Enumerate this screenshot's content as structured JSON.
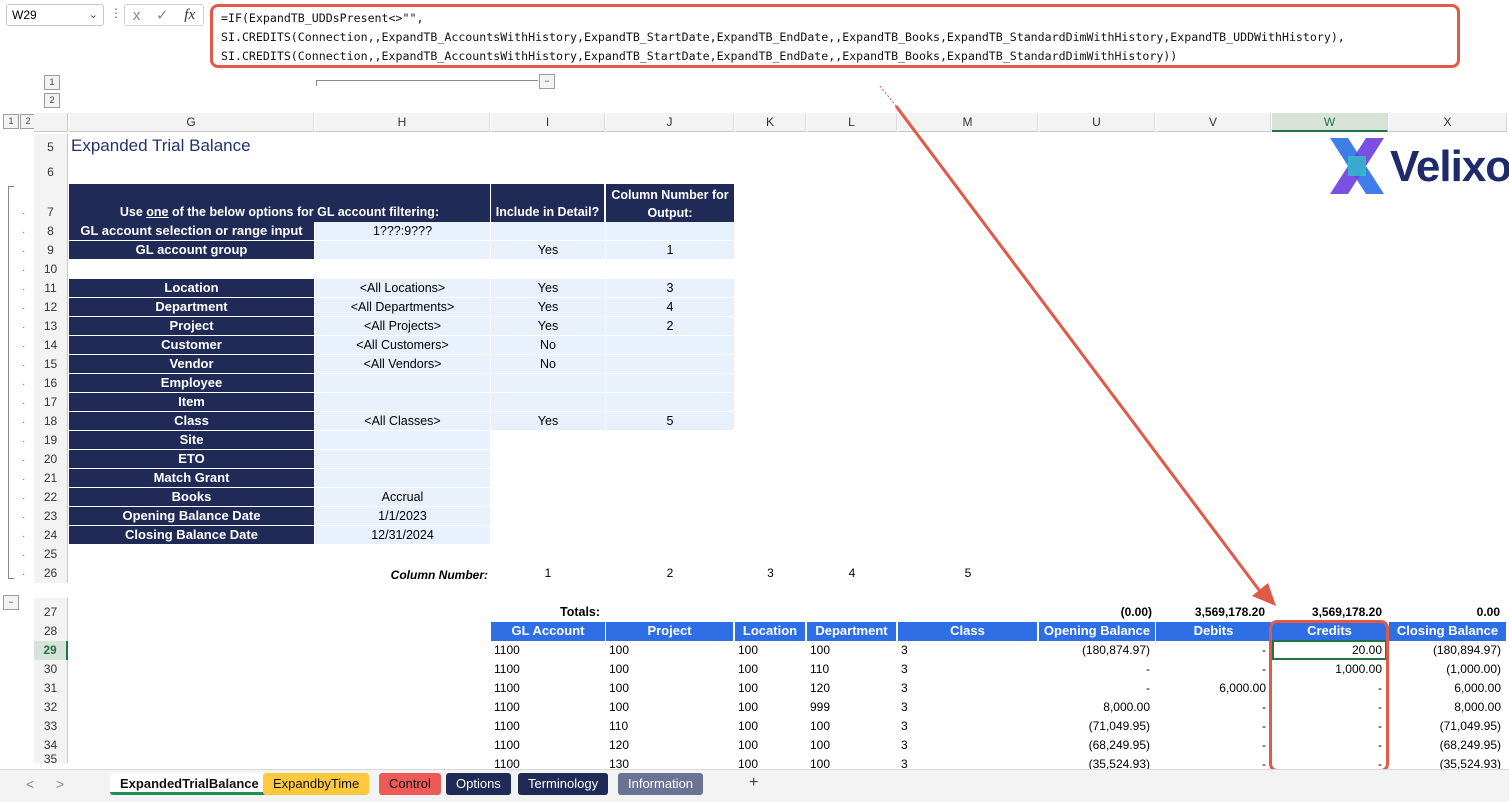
{
  "formula_bar": {
    "name_box": "W29",
    "formula_lines": [
      "=IF(ExpandTB_UDDsPresent<>\"\",",
      "SI.CREDITS(Connection,,ExpandTB_AccountsWithHistory,ExpandTB_StartDate,ExpandTB_EndDate,,ExpandTB_Books,ExpandTB_StandardDimWithHistory,ExpandTB_UDDWithHistory),",
      "SI.CREDITS(Connection,,ExpandTB_AccountsWithHistory,ExpandTB_StartDate,ExpandTB_EndDate,,ExpandTB_Books,ExpandTB_StandardDimWithHistory))"
    ],
    "fx_label": "fx",
    "cancel_icon": "x",
    "confirm_icon": "✓"
  },
  "outline": {
    "levels": [
      "1",
      "2"
    ],
    "collapse": "−"
  },
  "columns": [
    "G",
    "H",
    "I",
    "J",
    "K",
    "L",
    "M",
    "U",
    "V",
    "W",
    "X"
  ],
  "selected_column": "W",
  "rows": [
    "5",
    "6",
    "7",
    "8",
    "9",
    "10",
    "11",
    "12",
    "13",
    "14",
    "15",
    "16",
    "17",
    "18",
    "19",
    "20",
    "21",
    "22",
    "23",
    "24",
    "25",
    "26",
    "27",
    "28",
    "29",
    "30",
    "31",
    "32",
    "33",
    "34",
    "35"
  ],
  "selected_row": "29",
  "title": "Expanded Trial Balance",
  "logo_text": "Velixo",
  "filter_table": {
    "header_filter": "Use one of the below options for GL account filtering:",
    "header_filter_underlined": "one",
    "header_include": "Include in Detail?",
    "header_colnum": "Column Number for Output:",
    "rows": [
      {
        "label": "GL account selection or range input",
        "value": "1???:9???",
        "include": "",
        "colnum": ""
      },
      {
        "label": "GL account group",
        "value": "",
        "include": "Yes",
        "colnum": "1"
      },
      {
        "label": "Location",
        "value": "<All Locations>",
        "include": "Yes",
        "colnum": "3"
      },
      {
        "label": "Department",
        "value": "<All Departments>",
        "include": "Yes",
        "colnum": "4"
      },
      {
        "label": "Project",
        "value": "<All Projects>",
        "include": "Yes",
        "colnum": "2"
      },
      {
        "label": "Customer",
        "value": "<All Customers>",
        "include": "No",
        "colnum": ""
      },
      {
        "label": "Vendor",
        "value": "<All Vendors>",
        "include": "No",
        "colnum": ""
      },
      {
        "label": "Employee",
        "value": "",
        "include": "",
        "colnum": ""
      },
      {
        "label": "Item",
        "value": "",
        "include": "",
        "colnum": ""
      },
      {
        "label": "Class",
        "value": "<All Classes>",
        "include": "Yes",
        "colnum": "5"
      },
      {
        "label": "Site",
        "value": "",
        "include": "",
        "colnum": ""
      },
      {
        "label": "ETO",
        "value": "",
        "include": "",
        "colnum": ""
      },
      {
        "label": "Match Grant",
        "value": "",
        "include": "",
        "colnum": ""
      },
      {
        "label": "Books",
        "value": "Accrual",
        "include": "",
        "colnum": ""
      },
      {
        "label": "Opening Balance Date",
        "value": "1/1/2023",
        "include": "",
        "colnum": ""
      },
      {
        "label": "Closing Balance Date",
        "value": "12/31/2024",
        "include": "",
        "colnum": ""
      }
    ]
  },
  "column_number_row": {
    "label": "Column Number:",
    "values": [
      "1",
      "2",
      "3",
      "4",
      "5"
    ]
  },
  "totals": {
    "label": "Totals:",
    "opening": "(0.00)",
    "debits": "3,569,178.20",
    "credits": "3,569,178.20",
    "closing": "0.00"
  },
  "detail_headers": [
    "GL Account",
    "Project",
    "Location",
    "Department",
    "Class",
    "Opening Balance",
    "Debits",
    "Credits",
    "Closing Balance"
  ],
  "detail_rows": [
    {
      "gl": "1100",
      "project": "100",
      "location": "100",
      "department": "100",
      "class": "3",
      "opening": "(180,874.97)",
      "debits": "-",
      "credits": "20.00",
      "closing": "(180,894.97)"
    },
    {
      "gl": "1100",
      "project": "100",
      "location": "100",
      "department": "110",
      "class": "3",
      "opening": "-",
      "debits": "-",
      "credits": "1,000.00",
      "closing": "(1,000.00)"
    },
    {
      "gl": "1100",
      "project": "100",
      "location": "100",
      "department": "120",
      "class": "3",
      "opening": "-",
      "debits": "6,000.00",
      "credits": "-",
      "closing": "6,000.00"
    },
    {
      "gl": "1100",
      "project": "100",
      "location": "100",
      "department": "999",
      "class": "3",
      "opening": "8,000.00",
      "debits": "-",
      "credits": "-",
      "closing": "8,000.00"
    },
    {
      "gl": "1100",
      "project": "110",
      "location": "100",
      "department": "100",
      "class": "3",
      "opening": "(71,049.95)",
      "debits": "-",
      "credits": "-",
      "closing": "(71,049.95)"
    },
    {
      "gl": "1100",
      "project": "120",
      "location": "100",
      "department": "100",
      "class": "3",
      "opening": "(68,249.95)",
      "debits": "-",
      "credits": "-",
      "closing": "(68,249.95)"
    },
    {
      "gl": "1100",
      "project": "130",
      "location": "100",
      "department": "100",
      "class": "3",
      "opening": "(35,524.93)",
      "debits": "-",
      "credits": "-",
      "closing": "(35,524.93)"
    }
  ],
  "sheet_tabs": [
    {
      "label": "ExpandedTrialBalance",
      "style": "active"
    },
    {
      "label": "ExpandbyTime",
      "style": "yellow"
    },
    {
      "label": "Control",
      "style": "red"
    },
    {
      "label": "Options",
      "style": "navyt"
    },
    {
      "label": "Terminology",
      "style": "navyt"
    },
    {
      "label": "Information",
      "style": "grayblue"
    }
  ],
  "tab_nav": {
    "prev": "<",
    "next": ">",
    "add": "+"
  },
  "colors": {
    "navy": "#1f2a57",
    "header_blue": "#2f6fe6",
    "light_blue": "#e8f1fb",
    "highlight_red": "#e05a47",
    "excel_green": "#217346"
  }
}
